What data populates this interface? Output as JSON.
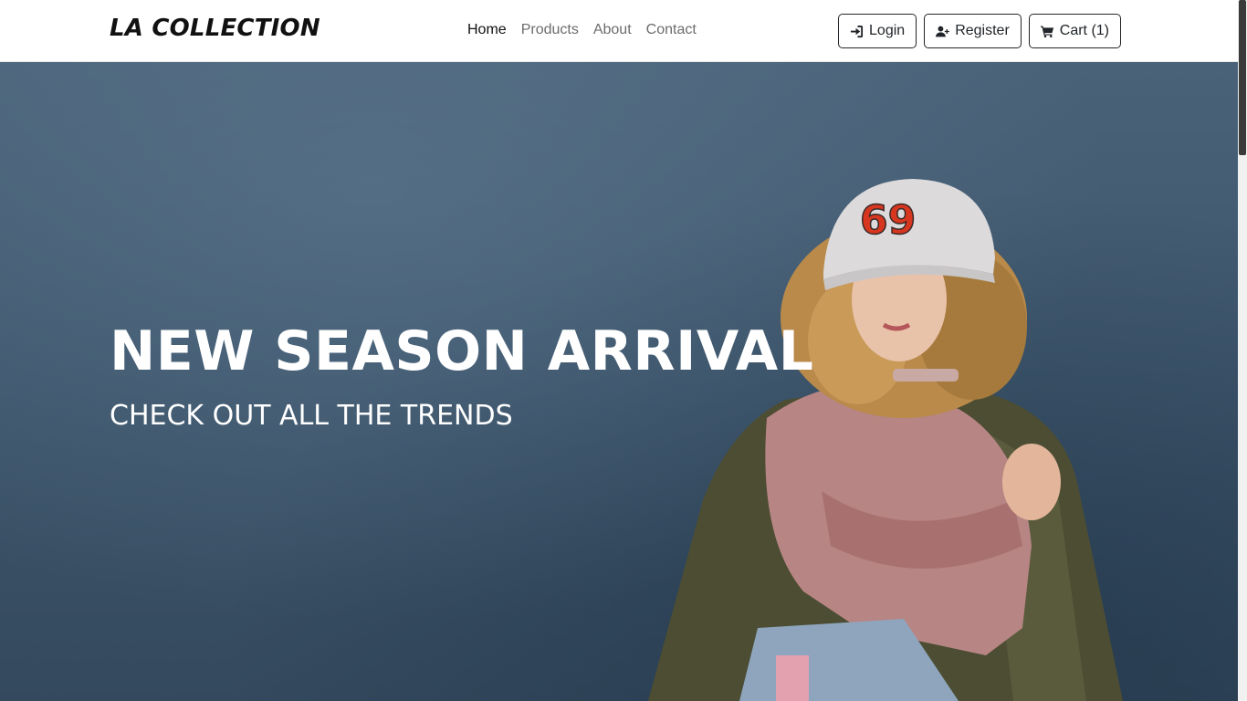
{
  "brand": {
    "name": "LA COLLECTION"
  },
  "nav": {
    "links": [
      {
        "label": "Home",
        "active": true
      },
      {
        "label": "Products",
        "active": false
      },
      {
        "label": "About",
        "active": false
      },
      {
        "label": "Contact",
        "active": false
      }
    ]
  },
  "auth": {
    "login_label": "Login",
    "register_label": "Register",
    "cart_label": "Cart (1)"
  },
  "hero": {
    "title": "NEW SEASON ARRIVAL",
    "subtitle": "CHECK OUT ALL THE TRENDS",
    "image_desc": "woman-in-cap-and-jacket"
  },
  "icons": {
    "login": "sign-in-icon",
    "register": "user-plus-icon",
    "cart": "shopping-cart-icon"
  },
  "colors": {
    "navbar_bg": "#ffffff",
    "hero_bg": "#3e566c",
    "text_primary": "#111111",
    "nav_inactive": "#6c6c6c",
    "cap_number": "#d7361f"
  },
  "cap": {
    "number": "69"
  }
}
